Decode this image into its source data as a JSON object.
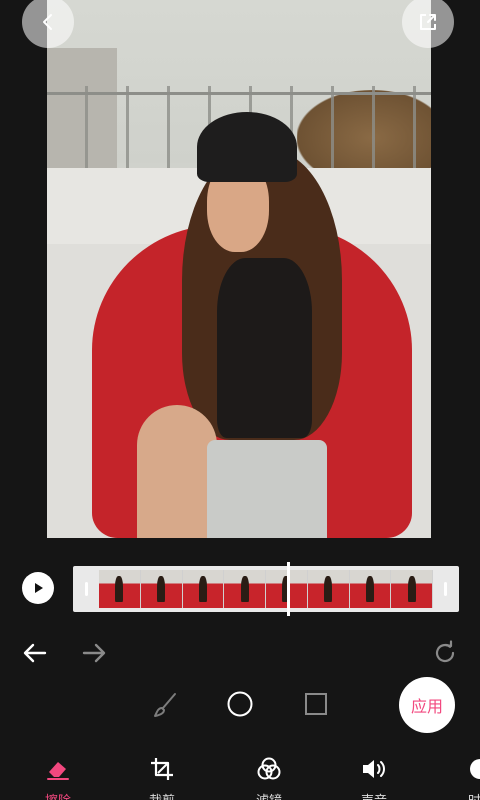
{
  "editor": {
    "apply_label": "应用"
  },
  "tabs": [
    {
      "label": "擦除",
      "icon": "eraser-icon",
      "active": true
    },
    {
      "label": "裁剪",
      "icon": "crop-icon",
      "active": false
    },
    {
      "label": "滤镜",
      "icon": "filter-icon",
      "active": false
    },
    {
      "label": "声音",
      "icon": "sound-icon",
      "active": false
    },
    {
      "label": "时",
      "icon": "time-icon",
      "active": false
    }
  ],
  "timeline": {
    "frame_count": 8
  },
  "colors": {
    "accent": "#f2487f",
    "background": "#151515"
  }
}
